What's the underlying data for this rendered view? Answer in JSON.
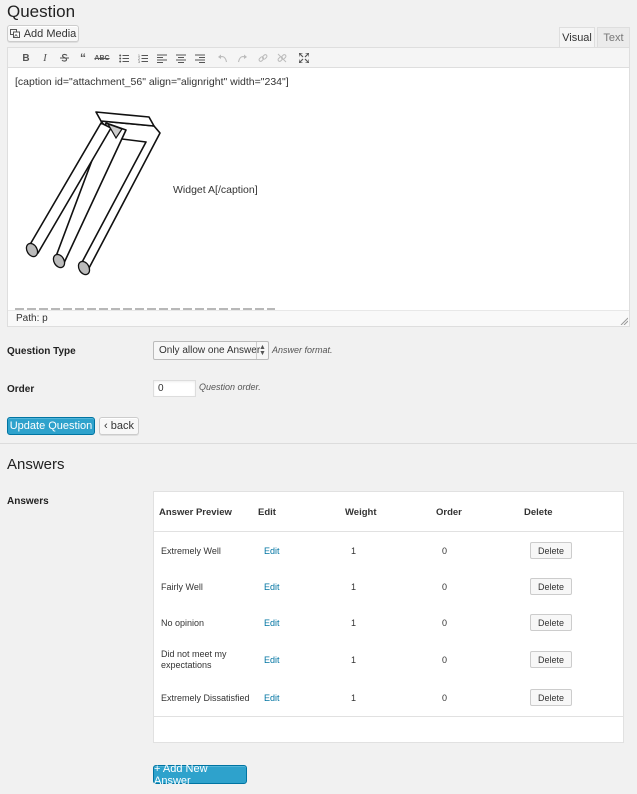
{
  "page_title": "Question",
  "add_media_label": "Add Media",
  "tabs": {
    "visual": "Visual",
    "text": "Text"
  },
  "editor": {
    "shortcode_open": "[caption id=\"attachment_56\" align=\"alignright\" width=\"234\"]",
    "caption_text": "Widget A[/caption]",
    "path_label": "Path: p"
  },
  "toolbar_icons": [
    "bold-icon",
    "italic-icon",
    "strikethrough-icon",
    "blockquote-icon",
    "horizontal-rule-icon",
    "bullet-list-icon",
    "numbered-list-icon",
    "align-left-icon",
    "align-center-icon",
    "align-right-icon",
    "undo-icon",
    "redo-icon",
    "link-icon",
    "unlink-icon",
    "fullscreen-icon"
  ],
  "question_type": {
    "label": "Question Type",
    "selected": "Only allow one Answer",
    "hint": "Answer format."
  },
  "order": {
    "label": "Order",
    "value": "0",
    "hint": "Question order."
  },
  "buttons": {
    "update": "Update Question",
    "back": "‹ back",
    "add_answer": "+ Add New Answer"
  },
  "answers_section": {
    "title": "Answers",
    "label": "Answers",
    "columns": [
      "Answer Preview",
      "Edit",
      "Weight",
      "Order",
      "Delete"
    ],
    "rows": [
      {
        "preview": "Extremely Well",
        "edit": "Edit",
        "weight": "1",
        "order": "0",
        "delete": "Delete"
      },
      {
        "preview": "Fairly Well",
        "edit": "Edit",
        "weight": "1",
        "order": "0",
        "delete": "Delete"
      },
      {
        "preview": "No opinion",
        "edit": "Edit",
        "weight": "1",
        "order": "0",
        "delete": "Delete"
      },
      {
        "preview": "Did not meet my expectations",
        "edit": "Edit",
        "weight": "1",
        "order": "0",
        "delete": "Delete"
      },
      {
        "preview": "Extremely Dissatisfied",
        "edit": "Edit",
        "weight": "1",
        "order": "0",
        "delete": "Delete"
      }
    ]
  },
  "colors": {
    "primary": "#2ea2cc",
    "primary_border": "#0074a2",
    "link": "#0074a2",
    "background": "#f1f1f1"
  }
}
